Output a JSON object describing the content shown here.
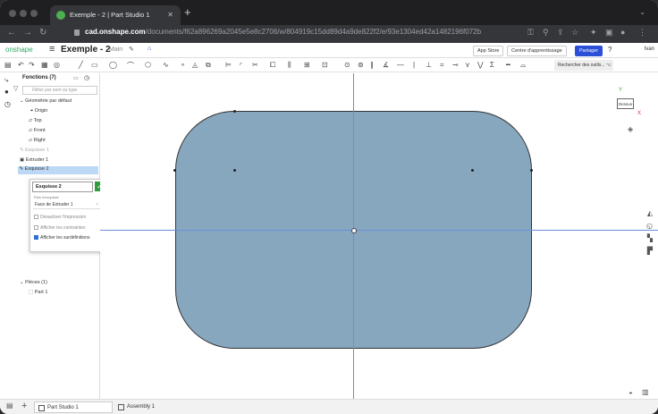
{
  "browser": {
    "tab_title": "Exemple - 2 | Part Studio 1",
    "url_host": "cad.onshape.com",
    "url_path": "/documents/f62a896269a2045e5e8c2706/w/804919c15dd89d4a9de822f2/e/93e1304ed42a1482196f072b"
  },
  "header": {
    "logo": "onshape",
    "doc_title": "Exemple - 2",
    "workspace": "Main",
    "app_store": "App Store",
    "learning": "Centre d'apprentissage",
    "share": "Partager",
    "user": "Ivan"
  },
  "toolbar": {
    "search_tools": "Rechercher des outils...",
    "search_shortcut": "⌥ C"
  },
  "features": {
    "header": "Fonctions (7)",
    "filter_placeholder": "Filtrer par nom ou type",
    "default_geometry": "Géométrie par défaut",
    "items": [
      "Origin",
      "Top",
      "Front",
      "Right",
      "Esquisse 1",
      "Extruder 1",
      "Esquisse 2"
    ],
    "parts_header": "Pièces (1)",
    "part": "Part 1"
  },
  "sketch_dialog": {
    "name": "Esquisse 2",
    "plane_label": "Plan d'esquisse",
    "plane_value": "Face de Extruder 1",
    "opt1": "Désactiver l'impression",
    "opt2": "Afficher les contraintes",
    "opt3": "Afficher les surdéfinitions",
    "opt3_checked": true
  },
  "view_cube": {
    "face": "Dessus",
    "x": "X",
    "y": "Y"
  },
  "bottom_tabs": [
    "Part Studio 1",
    "Assembly 1"
  ]
}
